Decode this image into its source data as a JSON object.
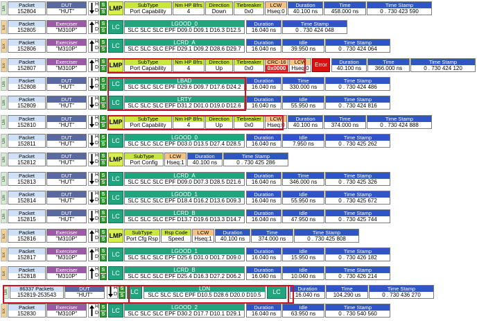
{
  "rows": [
    {
      "dir": "Dn",
      "packet_label": "Packet",
      "packet": "152804",
      "dev_label": "DUT",
      "dev": "\"HUT\"",
      "kind": "lmp",
      "lmp": {
        "label": "LMP",
        "subtype_label": "SubType",
        "subtype": "Port Capability",
        "nm_label": "Nm HP Bfrs",
        "nm": "4",
        "direction_label": "Direction",
        "direction": "Down",
        "tie_label": "Tiebreaker",
        "tie": "0x0"
      },
      "lcw": {
        "label": "LCW",
        "value": "Hseq:0"
      },
      "times": [
        {
          "label": "Duration",
          "value": "40.100 ns"
        },
        {
          "label": "Time",
          "value": "458.000 ns"
        },
        {
          "label": "Time Stamp",
          "value": "0 . 730 423 590"
        }
      ]
    },
    {
      "dir": "Ex",
      "packet_label": "Packet",
      "packet": "152805",
      "dev_label": "Exerciser",
      "dev": "\"M310P\"",
      "kind": "lc",
      "lc": {
        "label": "LC",
        "sym_label": "LGOOD_0",
        "sym": "SLC SLC SLC EPF D09.0 D09.1 D16.3 D12.5"
      },
      "times": [
        {
          "label": "Duration",
          "value": "16.040 ns"
        },
        {
          "label": "Time Stamp",
          "value": "0 . 730 424 048"
        }
      ]
    },
    {
      "dir": "Ex",
      "packet_label": "Packet",
      "packet": "152806",
      "dev_label": "Exerciser",
      "dev": "\"M310P\"",
      "kind": "lc",
      "lc": {
        "label": "LC",
        "sym_label": "LCRD_A",
        "sym": "SLC SLC SLC EPF D29.1 D09.2 D28.6 D29.7"
      },
      "times": [
        {
          "label": "Duration",
          "value": "16.040 ns"
        },
        {
          "label": "Idle",
          "value": "39.950 ns"
        },
        {
          "label": "Time Stamp",
          "value": "0 . 730 424 064"
        }
      ]
    },
    {
      "dir": "Ex",
      "packet_label": "Packet",
      "packet": "152807",
      "dev_label": "Exerciser",
      "dev": "\"M310P\"",
      "kind": "lmp",
      "lmp": {
        "label": "LMP",
        "subtype_label": "SubType",
        "subtype": "Port Capability",
        "nm_label": "Nm HP Bfrs",
        "nm": "4",
        "direction_label": "Direction",
        "direction": "Up",
        "tie_label": "Tiebreaker",
        "tie": "0x0"
      },
      "crc": {
        "label": "CRC-16",
        "value": "0x0000"
      },
      "lcw": {
        "label": "LCW",
        "value": "Hseq:0"
      },
      "err": "Error",
      "times": [
        {
          "label": "Duration",
          "value": "40.100 ns"
        },
        {
          "label": "Time",
          "value": "366.000 ns"
        },
        {
          "label": "Time Stamp",
          "value": "0 . 730 424 120"
        }
      ]
    },
    {
      "dir": "Dn",
      "packet_label": "Packet",
      "packet": "152808",
      "dev_label": "DUT",
      "dev": "\"HUT\"",
      "kind": "lc",
      "lc": {
        "label": "LC",
        "sym_label": "LBAD",
        "sym": "SLC SLC SLC EPF D29.6 D09.7 D17.6 D24.2"
      },
      "times": [
        {
          "label": "Duration",
          "value": "16.040 ns"
        },
        {
          "label": "Time",
          "value": "330.000 ns"
        },
        {
          "label": "Time Stamp",
          "value": "0 . 730 424 486"
        }
      ]
    },
    {
      "dir": "Dn",
      "packet_label": "Packet",
      "packet": "152809",
      "dev_label": "DUT",
      "dev": "\"HUT\"",
      "kind": "lc",
      "lc": {
        "label": "LC",
        "sym_label": "LRTY",
        "sym": "SLC SLC SLC EPF D31.2 D01.0 D19.0 D12.6"
      },
      "times": [
        {
          "label": "Duration",
          "value": "16.040 ns"
        },
        {
          "label": "Idle",
          "value": "55.950 ns"
        },
        {
          "label": "Time Stamp",
          "value": "0 . 730 424 816"
        }
      ]
    },
    {
      "dir": "Dn",
      "packet_label": "Packet",
      "packet": "152810",
      "dev_label": "DUT",
      "dev": "\"HUT\"",
      "kind": "lmp",
      "lmp": {
        "label": "LMP",
        "subtype_label": "SubType",
        "subtype": "Port Capability",
        "nm_label": "Nm HP Bfrs",
        "nm": "4",
        "direction_label": "Direction",
        "direction": "Up",
        "tie_label": "Tiebreaker",
        "tie": "0x0"
      },
      "lcw": {
        "label": "LCW",
        "value": "Hseq:0"
      },
      "times": [
        {
          "label": "Duration",
          "value": "40.100 ns"
        },
        {
          "label": "Time",
          "value": "374.000 ns"
        },
        {
          "label": "Time Stamp",
          "value": "0 . 730 424 888"
        }
      ]
    },
    {
      "dir": "Dn",
      "packet_label": "Packet",
      "packet": "152811",
      "dev_label": "DUT",
      "dev": "\"HUT\"",
      "kind": "lc",
      "lc": {
        "label": "LC",
        "sym_label": "LGOOD_0",
        "sym": "SLC SLC SLC EPF D03.0 D13.5 D27.4 D28.5"
      },
      "times": [
        {
          "label": "Duration",
          "value": "16.040 ns"
        },
        {
          "label": "Idle",
          "value": "7.950 ns"
        },
        {
          "label": "Time Stamp",
          "value": "0 . 730 425 262"
        }
      ]
    },
    {
      "dir": "Dn",
      "packet_label": "Packet",
      "packet": "152812",
      "dev_label": "DUT",
      "dev": "\"HUT\"",
      "kind": "lmp2",
      "lmp": {
        "label": "LMP",
        "subtype_label": "SubType",
        "subtype": "Port Config"
      },
      "lcw": {
        "label": "LCW",
        "value": "Hseq:1"
      },
      "times": [
        {
          "label": "Duration",
          "value": "40.100 ns"
        },
        {
          "label": "Time Stamp",
          "value": "0 . 730 425 286"
        }
      ]
    },
    {
      "dir": "Dn",
      "packet_label": "Packet",
      "packet": "152813",
      "dev_label": "DUT",
      "dev": "\"HUT\"",
      "kind": "lc",
      "lc": {
        "label": "LC",
        "sym_label": "LCRD_A",
        "sym": "SLC SLC SLC EPF D09.0 D07.3 D28.5 D21.6"
      },
      "times": [
        {
          "label": "Duration",
          "value": "16.040 ns"
        },
        {
          "label": "Time",
          "value": "346.000 ns"
        },
        {
          "label": "Time Stamp",
          "value": "0 . 730 425 326"
        }
      ]
    },
    {
      "dir": "Dn",
      "packet_label": "Packet",
      "packet": "152814",
      "dev_label": "DUT",
      "dev": "\"HUT\"",
      "kind": "lc",
      "lc": {
        "label": "LC",
        "sym_label": "LGOOD_1",
        "sym": "SLC SLC SLC EPF D18.4 D16.2 D13.6 D09.3"
      },
      "times": [
        {
          "label": "Duration",
          "value": "16.040 ns"
        },
        {
          "label": "Idle",
          "value": "55.950 ns"
        },
        {
          "label": "Time Stamp",
          "value": "0 . 730 425 672"
        }
      ]
    },
    {
      "dir": "Dn",
      "packet_label": "Packet",
      "packet": "152815",
      "dev_label": "DUT",
      "dev": "\"HUT\"",
      "kind": "lc",
      "lc": {
        "label": "LC",
        "sym_label": "LCRD_B",
        "sym": "SLC SLC SLC EPF D13.7 D19.6 D13.3 D14.7"
      },
      "times": [
        {
          "label": "Duration",
          "value": "16.040 ns"
        },
        {
          "label": "Idle",
          "value": "47.950 ns"
        },
        {
          "label": "Time Stamp",
          "value": "0 . 730 425 744"
        }
      ]
    },
    {
      "dir": "Ex",
      "packet_label": "Packet",
      "packet": "152816",
      "dev_label": "Exerciser",
      "dev": "\"M310P\"",
      "kind": "lmp3",
      "lmp": {
        "label": "LMP",
        "subtype_label": "SubType",
        "subtype": "Port Cfg Rsp",
        "rsp_label": "Rsp Code",
        "rsp": "Speed"
      },
      "lcw": {
        "label": "LCW",
        "value": "Hseq:1"
      },
      "times": [
        {
          "label": "Duration",
          "value": "40.100 ns"
        },
        {
          "label": "Time",
          "value": "374.000 ns"
        },
        {
          "label": "Time Stamp",
          "value": "0 . 730 425 808"
        }
      ]
    },
    {
      "dir": "Ex",
      "packet_label": "Packet",
      "packet": "152817",
      "dev_label": "Exerciser",
      "dev": "\"M310P\"",
      "kind": "lc",
      "lc": {
        "label": "LC",
        "sym_label": "LGOOD_1",
        "sym": "SLC SLC SLC EPF D25.6 D31.0 D01.7 D09.0"
      },
      "times": [
        {
          "label": "Duration",
          "value": "16.040 ns"
        },
        {
          "label": "Idle",
          "value": "15.950 ns"
        },
        {
          "label": "Time Stamp",
          "value": "0 . 730 426 182"
        }
      ]
    },
    {
      "dir": "Ex",
      "packet_label": "Packet",
      "packet": "152818",
      "dev_label": "Exerciser",
      "dev": "\"M310P\"",
      "kind": "lc",
      "lc": {
        "label": "LC",
        "sym_label": "LCRD_B",
        "sym": "SLC SLC SLC EPF D25.4 D16.3 D27.2 D06.2"
      },
      "times": [
        {
          "label": "Duration",
          "value": "16.040 ns"
        },
        {
          "label": "Idle",
          "value": "10.040 ns"
        },
        {
          "label": "Time Stamp",
          "value": "0 . 730 426 214"
        }
      ]
    },
    {
      "dir": "Dn",
      "packet_label": "86337 Packets",
      "packet": "152819-253543",
      "dev_label": "DUT",
      "dev": "\"HUT\"",
      "kind": "ldn",
      "lc": {
        "label": "LC",
        "sym_label": "LDN",
        "sym": "SLC SLC SLC EPF D10.5 D28.6 D20.0 D10.5",
        "label2": "LC"
      },
      "times": [
        {
          "label": "Duration",
          "value": "16.040 ns"
        },
        {
          "label": "Time",
          "value": "104.290 us"
        },
        {
          "label": "Time Stamp",
          "value": "0 . 730 436 270"
        }
      ]
    },
    {
      "dir": "Ex",
      "packet_label": "Packet",
      "packet": "152830",
      "dev_label": "Exerciser",
      "dev": "\"M310P\"",
      "kind": "lc",
      "lc": {
        "label": "LC",
        "sym_label": "LGOOD_2",
        "sym": "SLC SLC SLC EPF D30.2 D17.7 D10.1 D29.1"
      },
      "times": [
        {
          "label": "Duration",
          "value": "16.040 ns"
        },
        {
          "label": "Idle",
          "value": "63.950 ns"
        },
        {
          "label": "Time Stamp",
          "value": "0 . 730 540 560"
        }
      ]
    }
  ],
  "hdc": {
    "h": "H",
    "d": "D",
    "c": "C",
    "s": "S"
  },
  "colors": {
    "dn_row": "#d2ecd0",
    "ex_row": "#f3cf94",
    "lc": "#22a57e",
    "lmp": "#d9ef4d",
    "time": "#2f55c6",
    "error": "#d81010"
  }
}
